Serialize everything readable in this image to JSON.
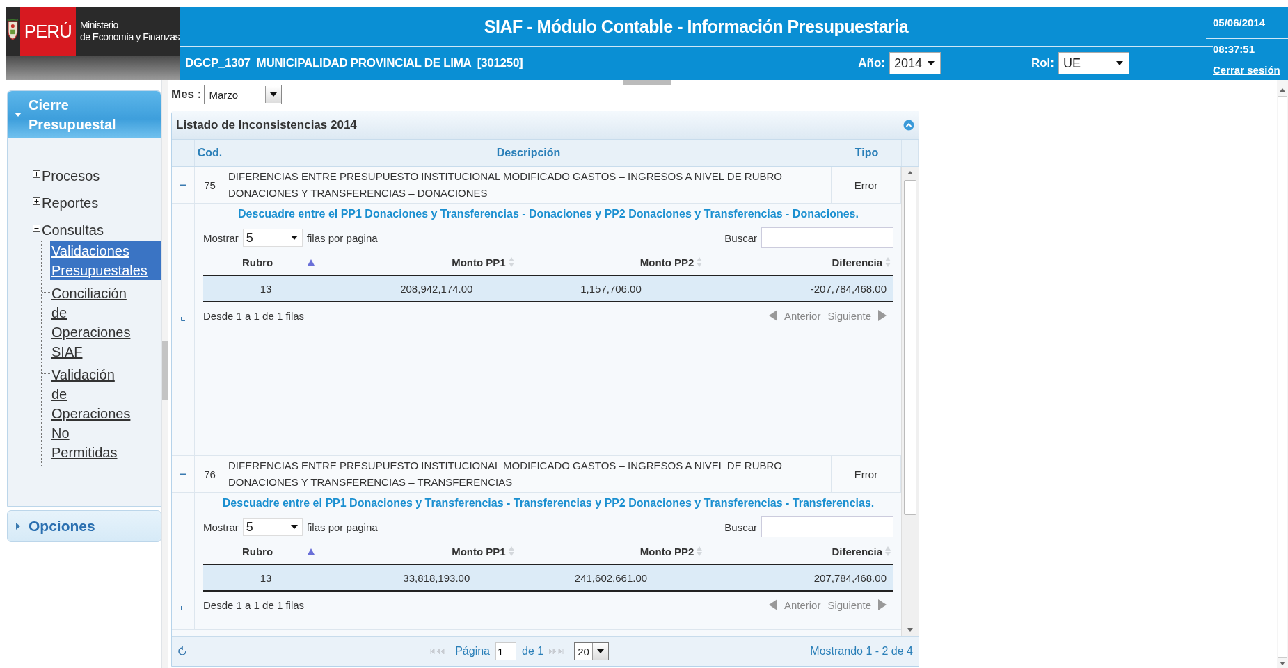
{
  "header": {
    "logo": {
      "country": "PERÚ",
      "ministry_line1": "Ministerio",
      "ministry_line2": "de Economía y Finanzas"
    },
    "title": "SIAF - Módulo Contable - Información Presupuestaria",
    "entity": "DGCP_1307  MUNICIPALIDAD PROVINCIAL DE LIMA  [301250]",
    "year_label": "Año:",
    "year": "2014",
    "role_label": "Rol:",
    "role": "UE",
    "date": "05/06/2014",
    "time": "08:37:51",
    "logout": "Cerrar sesión"
  },
  "sidebar": {
    "sections": [
      {
        "title": "Cierre Presupuestal",
        "expanded": true,
        "items": [
          {
            "label": "Procesos",
            "expanded": false
          },
          {
            "label": "Reportes",
            "expanded": false
          },
          {
            "label": "Consultas",
            "expanded": true,
            "children": [
              {
                "label": "Validaciones Presupuestales",
                "selected": true
              },
              {
                "label": "Conciliación de Operaciones SIAF",
                "selected": false
              },
              {
                "label": "Validación de Operaciones No Permitidas",
                "selected": false
              }
            ]
          }
        ]
      },
      {
        "title": "Opciones",
        "expanded": false
      }
    ]
  },
  "month_filter": {
    "label": "Mes :",
    "value": "Marzo"
  },
  "panel": {
    "title": "Listado de Inconsistencias 2014",
    "columns": [
      "Cod.",
      "Descripción",
      "Tipo"
    ],
    "rows": [
      {
        "cod": "75",
        "description": "DIFERENCIAS ENTRE PRESUPUESTO INSTITUCIONAL MODIFICADO GASTOS – INGRESOS A NIVEL DE RUBRO DONACIONES Y TRANSFERENCIAS – DONACIONES",
        "type": "Error",
        "expanded": true,
        "detail": {
          "title": "Descuadre entre el PP1 Donaciones y Transferencias - Donaciones y PP2 Donaciones y Transferencias - Donaciones.",
          "show_label": "Mostrar",
          "page_size": "5",
          "per_page_label": "filas por pagina",
          "search_label": "Buscar",
          "columns": [
            {
              "label": "Rubro",
              "sorted": true
            },
            {
              "label": "Monto PP1",
              "sorted": false
            },
            {
              "label": "Monto PP2",
              "sorted": false
            },
            {
              "label": "Diferencia",
              "sorted": false
            }
          ],
          "rows": [
            [
              "13",
              "208,942,174.00",
              "1,157,706.00",
              "-207,784,468.00"
            ]
          ],
          "info": "Desde 1 a 1 de 1 filas",
          "prev": "Anterior",
          "next": "Siguiente"
        }
      },
      {
        "cod": "76",
        "description": "DIFERENCIAS ENTRE PRESUPUESTO INSTITUCIONAL MODIFICADO GASTOS – INGRESOS A NIVEL DE RUBRO DONACIONES Y TRANSFERENCIAS – TRANSFERENCIAS",
        "type": "Error",
        "expanded": true,
        "detail": {
          "title": "Descuadre entre el PP1 Donaciones y Transferencias - Transferencias y PP2 Donaciones y Transferencias - Transferencias.",
          "show_label": "Mostrar",
          "page_size": "5",
          "per_page_label": "filas por pagina",
          "search_label": "Buscar",
          "columns": [
            {
              "label": "Rubro",
              "sorted": true
            },
            {
              "label": "Monto PP1",
              "sorted": false
            },
            {
              "label": "Monto PP2",
              "sorted": false
            },
            {
              "label": "Diferencia",
              "sorted": false
            }
          ],
          "rows": [
            [
              "13",
              "33,818,193.00",
              "241,602,661.00",
              "207,784,468.00"
            ]
          ],
          "info": "Desde 1 a 1 de 1 filas",
          "prev": "Anterior",
          "next": "Siguiente"
        }
      }
    ],
    "pager": {
      "page_label": "Página",
      "page": "1",
      "of_label": "de 1",
      "page_size": "20",
      "summary": "Mostrando 1 - 2 de 4"
    }
  }
}
